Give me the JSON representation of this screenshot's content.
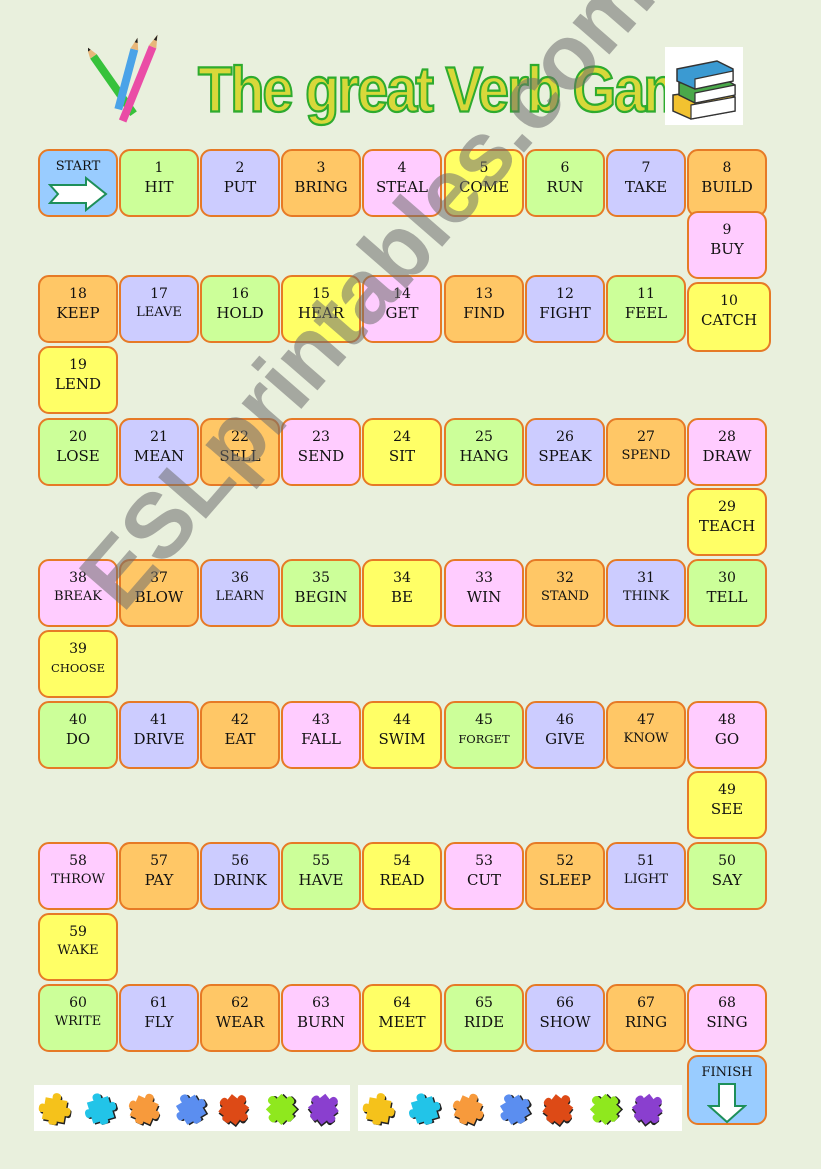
{
  "title": "The great Verb Game",
  "start_label": "START",
  "finish_label": "FINISH",
  "colors": {
    "background": "#e9f0dd",
    "border": "#e67a26",
    "green": "#ccff99",
    "lilac": "#ccccff",
    "orange": "#ffc766",
    "pink": "#ffccff",
    "yellow": "#ffff66",
    "blue": "#99ccff",
    "title_fill": "#d8d83a",
    "title_outline": "#2eab2e"
  },
  "watermark": "ESLprintables.com",
  "icons": {
    "pencils": "pencils-icon",
    "books": "books-icon",
    "start_arrow": "arrow-right-icon",
    "finish_arrow": "arrow-down-icon",
    "puzzle": "puzzle-piece-icon"
  },
  "squares": [
    {
      "n": "1",
      "verb": "HIT",
      "color": "green"
    },
    {
      "n": "2",
      "verb": "PUT",
      "color": "lilac"
    },
    {
      "n": "3",
      "verb": "BRING",
      "color": "orange"
    },
    {
      "n": "4",
      "verb": "STEAL",
      "color": "pink"
    },
    {
      "n": "5",
      "verb": "COME",
      "color": "yellow"
    },
    {
      "n": "6",
      "verb": "RUN",
      "color": "green"
    },
    {
      "n": "7",
      "verb": "TAKE",
      "color": "lilac"
    },
    {
      "n": "8",
      "verb": "BUILD",
      "color": "orange"
    },
    {
      "n": "9",
      "verb": "BUY",
      "color": "pink"
    },
    {
      "n": "10",
      "verb": "CATCH",
      "color": "yellow"
    },
    {
      "n": "11",
      "verb": "FEEL",
      "color": "green"
    },
    {
      "n": "12",
      "verb": "FIGHT",
      "color": "lilac"
    },
    {
      "n": "13",
      "verb": "FIND",
      "color": "orange"
    },
    {
      "n": "14",
      "verb": "GET",
      "color": "pink"
    },
    {
      "n": "15",
      "verb": "HEAR",
      "color": "yellow"
    },
    {
      "n": "16",
      "verb": "HOLD",
      "color": "green"
    },
    {
      "n": "17",
      "verb": "LEAVE",
      "color": "lilac"
    },
    {
      "n": "18",
      "verb": "KEEP",
      "color": "orange"
    },
    {
      "n": "19",
      "verb": "LEND",
      "color": "yellow"
    },
    {
      "n": "20",
      "verb": "LOSE",
      "color": "green"
    },
    {
      "n": "21",
      "verb": "MEAN",
      "color": "lilac"
    },
    {
      "n": "22",
      "verb": "SELL",
      "color": "orange"
    },
    {
      "n": "23",
      "verb": "SEND",
      "color": "pink"
    },
    {
      "n": "24",
      "verb": "SIT",
      "color": "yellow"
    },
    {
      "n": "25",
      "verb": "HANG",
      "color": "green"
    },
    {
      "n": "26",
      "verb": "SPEAK",
      "color": "lilac"
    },
    {
      "n": "27",
      "verb": "SPEND",
      "color": "orange"
    },
    {
      "n": "28",
      "verb": "DRAW",
      "color": "pink"
    },
    {
      "n": "29",
      "verb": "TEACH",
      "color": "yellow"
    },
    {
      "n": "30",
      "verb": "TELL",
      "color": "green"
    },
    {
      "n": "31",
      "verb": "THINK",
      "color": "lilac"
    },
    {
      "n": "32",
      "verb": "STAND",
      "color": "orange"
    },
    {
      "n": "33",
      "verb": "WIN",
      "color": "pink"
    },
    {
      "n": "34",
      "verb": "BE",
      "color": "yellow"
    },
    {
      "n": "35",
      "verb": "BEGIN",
      "color": "green"
    },
    {
      "n": "36",
      "verb": "LEARN",
      "color": "lilac"
    },
    {
      "n": "37",
      "verb": "BLOW",
      "color": "orange"
    },
    {
      "n": "38",
      "verb": "BREAK",
      "color": "pink"
    },
    {
      "n": "39",
      "verb": "CHOOSE",
      "color": "yellow"
    },
    {
      "n": "40",
      "verb": "DO",
      "color": "green"
    },
    {
      "n": "41",
      "verb": "DRIVE",
      "color": "lilac"
    },
    {
      "n": "42",
      "verb": "EAT",
      "color": "orange"
    },
    {
      "n": "43",
      "verb": "FALL",
      "color": "pink"
    },
    {
      "n": "44",
      "verb": "SWIM",
      "color": "yellow"
    },
    {
      "n": "45",
      "verb": "FORGET",
      "color": "green"
    },
    {
      "n": "46",
      "verb": "GIVE",
      "color": "lilac"
    },
    {
      "n": "47",
      "verb": "KNOW",
      "color": "orange"
    },
    {
      "n": "48",
      "verb": "GO",
      "color": "pink"
    },
    {
      "n": "49",
      "verb": "SEE",
      "color": "yellow"
    },
    {
      "n": "50",
      "verb": "SAY",
      "color": "green"
    },
    {
      "n": "51",
      "verb": "LIGHT",
      "color": "lilac"
    },
    {
      "n": "52",
      "verb": "SLEEP",
      "color": "orange"
    },
    {
      "n": "53",
      "verb": "CUT",
      "color": "pink"
    },
    {
      "n": "54",
      "verb": "READ",
      "color": "yellow"
    },
    {
      "n": "55",
      "verb": "HAVE",
      "color": "green"
    },
    {
      "n": "56",
      "verb": "DRINK",
      "color": "lilac"
    },
    {
      "n": "57",
      "verb": "PAY",
      "color": "orange"
    },
    {
      "n": "58",
      "verb": "THROW",
      "color": "pink"
    },
    {
      "n": "59",
      "verb": "WAKE",
      "color": "yellow"
    },
    {
      "n": "60",
      "verb": "WRITE",
      "color": "green"
    },
    {
      "n": "61",
      "verb": "FLY",
      "color": "lilac"
    },
    {
      "n": "62",
      "verb": "WEAR",
      "color": "orange"
    },
    {
      "n": "63",
      "verb": "BURN",
      "color": "pink"
    },
    {
      "n": "64",
      "verb": "MEET",
      "color": "yellow"
    },
    {
      "n": "65",
      "verb": "RIDE",
      "color": "green"
    },
    {
      "n": "66",
      "verb": "SHOW",
      "color": "lilac"
    },
    {
      "n": "67",
      "verb": "RING",
      "color": "orange"
    },
    {
      "n": "68",
      "verb": "SING",
      "color": "pink"
    }
  ],
  "puzzle_colors": [
    "#f5c21b",
    "#22c4e8",
    "#f79a3c",
    "#5b8ef0",
    "#dd4a16",
    "#8fe81e",
    "#8a3fcf"
  ]
}
